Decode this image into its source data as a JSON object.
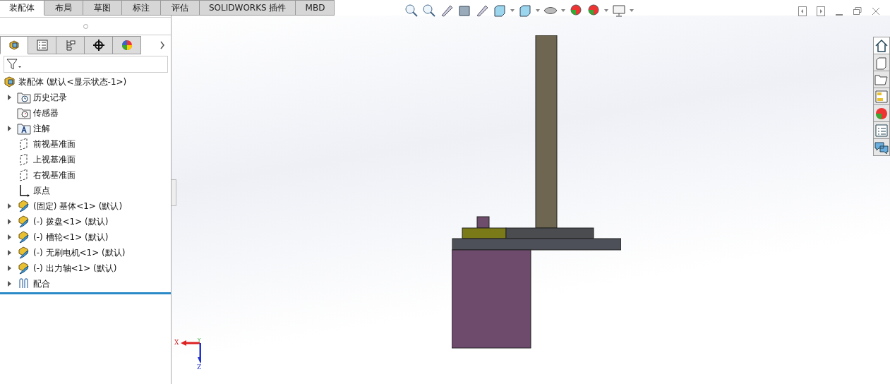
{
  "tabs": [
    {
      "label": "装配体",
      "selected": true
    },
    {
      "label": "布局",
      "selected": false
    },
    {
      "label": "草图",
      "selected": false
    },
    {
      "label": "标注",
      "selected": false
    },
    {
      "label": "评估",
      "selected": false
    },
    {
      "label": "SOLIDWORKS 插件",
      "selected": false
    },
    {
      "label": "MBD",
      "selected": false
    }
  ],
  "panel_tabs": [
    {
      "kind": "feature",
      "selected": true
    },
    {
      "kind": "property",
      "selected": false
    },
    {
      "kind": "config",
      "selected": false
    },
    {
      "kind": "dimxpert",
      "selected": false
    },
    {
      "kind": "display",
      "selected": false
    }
  ],
  "tree": {
    "root": "装配体  (默认<显示状态-1>)",
    "items": [
      {
        "label": "历史记录",
        "kind": "history",
        "has_children": true
      },
      {
        "label": "传感器",
        "kind": "sensor",
        "has_children": false
      },
      {
        "label": "注解",
        "kind": "annotation",
        "has_children": true
      },
      {
        "label": "前视基准面",
        "kind": "plane",
        "has_children": false
      },
      {
        "label": "上视基准面",
        "kind": "plane",
        "has_children": false
      },
      {
        "label": "右视基准面",
        "kind": "plane",
        "has_children": false
      },
      {
        "label": "原点",
        "kind": "origin",
        "has_children": false
      },
      {
        "label": "(固定) 基体<1> (默认)",
        "kind": "part",
        "has_children": true
      },
      {
        "label": "(-) 拨盘<1> (默认)",
        "kind": "part",
        "has_children": true
      },
      {
        "label": "(-) 槽轮<1> (默认)",
        "kind": "part",
        "has_children": true
      },
      {
        "label": "(-) 无刷电机<1> (默认)",
        "kind": "part",
        "has_children": true
      },
      {
        "label": "(-) 出力轴<1> (默认)",
        "kind": "part",
        "has_children": true
      },
      {
        "label": "配合",
        "kind": "mate",
        "has_children": true
      }
    ]
  },
  "triad": {
    "x": "X",
    "y": "Y",
    "z": "Z"
  }
}
